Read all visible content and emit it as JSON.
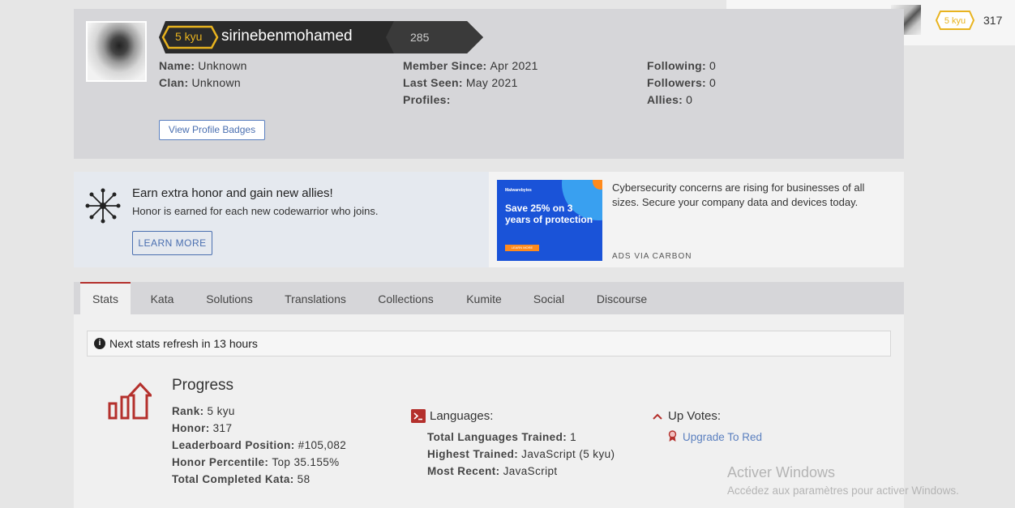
{
  "topbar": {
    "theme_icon": "sun-icon",
    "bookmark_icon": "bookmark-star-icon",
    "notification_icon": "bell-icon",
    "rank": "5 kyu",
    "honor": "317"
  },
  "profile": {
    "rank": "5 kyu",
    "username": "sirinebenmohamed",
    "score": "285",
    "col1": [
      {
        "label": "Name:",
        "value": "Unknown"
      },
      {
        "label": "Clan:",
        "value": "Unknown"
      }
    ],
    "col2": [
      {
        "label": "Member Since:",
        "value": "Apr 2021"
      },
      {
        "label": "Last Seen:",
        "value": "May 2021"
      },
      {
        "label": "Profiles:",
        "value": ""
      }
    ],
    "col3": [
      {
        "label": "Following:",
        "value": "0"
      },
      {
        "label": "Followers:",
        "value": "0"
      },
      {
        "label": "Allies:",
        "value": "0"
      }
    ],
    "badges_button": "View Profile Badges"
  },
  "promo": {
    "title": "Earn extra honor and gain new allies!",
    "subtitle": "Honor is earned for each new codewarrior who joins.",
    "button": "LEARN MORE"
  },
  "ad": {
    "brand": "Malwarebytes",
    "headline": "Save 25% on 3 years of protection",
    "cta": "LEARN MORE",
    "text": "Cybersecurity concerns are rising for businesses of all sizes. Secure your company data and devices today.",
    "via": "ADS VIA CARBON"
  },
  "tabs": [
    "Stats",
    "Kata",
    "Solutions",
    "Translations",
    "Collections",
    "Kumite",
    "Social",
    "Discourse"
  ],
  "notice": "Next stats refresh in 13 hours",
  "progress": {
    "title": "Progress",
    "items": [
      {
        "label": "Rank:",
        "value": "5 kyu"
      },
      {
        "label": "Honor:",
        "value": "317"
      },
      {
        "label": "Leaderboard Position:",
        "value": "#105,082"
      },
      {
        "label": "Honor Percentile:",
        "value": "Top 35.155%"
      },
      {
        "label": "Total Completed Kata:",
        "value": "58"
      }
    ]
  },
  "languages": {
    "title": "Languages:",
    "items": [
      {
        "label": "Total Languages Trained:",
        "value": "1"
      },
      {
        "label": "Highest Trained:",
        "value": "JavaScript (5 kyu)"
      },
      {
        "label": "Most Recent:",
        "value": "JavaScript"
      }
    ]
  },
  "upvotes": {
    "title": "Up Votes:",
    "link": "Upgrade To Red"
  },
  "watermark": {
    "line1": "Activer Windows",
    "line2": "Accédez aux paramètres pour activer Windows."
  },
  "colors": {
    "accent_red": "#b4302c",
    "rank_yellow": "#e8b31f",
    "link_blue": "#4a6fb0"
  }
}
